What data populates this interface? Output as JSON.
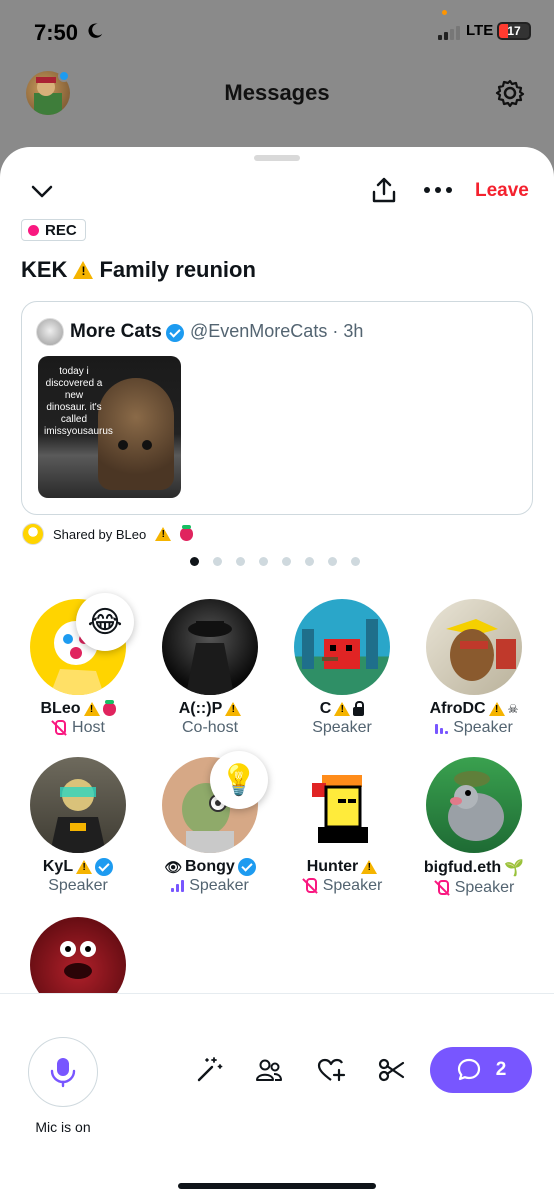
{
  "status": {
    "time": "7:50",
    "network": "LTE",
    "battery": "17"
  },
  "background": {
    "title": "Messages"
  },
  "header": {
    "leave_label": "Leave",
    "rec_label": "REC"
  },
  "space": {
    "title_pre": "KEK",
    "title_post": "Family reunion"
  },
  "tweet": {
    "author_name": "More Cats",
    "author_handle": "@EvenMoreCats",
    "time": "3h",
    "media_caption": "today i discovered a new dinosaur. it's called imissyousaurus"
  },
  "shared": {
    "label": "Shared by BLeo"
  },
  "pager": {
    "count": 8,
    "active": 0
  },
  "participants": [
    {
      "name": "BLeo",
      "role": "Host"
    },
    {
      "name": "A(::)P",
      "role": "Co-host"
    },
    {
      "name": "C",
      "role": "Speaker"
    },
    {
      "name": "AfroDC",
      "role": "Speaker"
    },
    {
      "name": "KyL",
      "role": "Speaker"
    },
    {
      "name": "Bongy",
      "role": "Speaker"
    },
    {
      "name": "Hunter",
      "role": "Speaker"
    },
    {
      "name": "bigfud.eth",
      "role": "Speaker"
    }
  ],
  "reactions": {
    "bleo": "😂",
    "bongy": "💡"
  },
  "controls": {
    "mic_label": "Mic is on",
    "chat_count": "2"
  },
  "colors": {
    "accent": "#7856ff",
    "leave": "#f4212e",
    "rec": "#f91880",
    "verified": "#1d9bf0"
  }
}
